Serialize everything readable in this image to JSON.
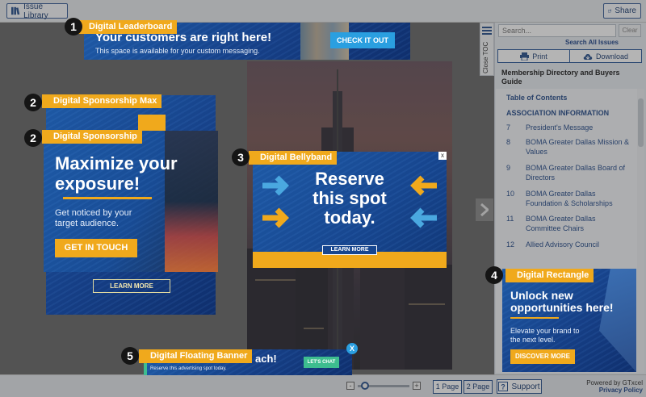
{
  "topbar": {
    "issue_library": "Issue Library",
    "share": "Share"
  },
  "toc": {
    "tab_label": "Close TOC",
    "search_placeholder": "Search...",
    "clear": "Clear",
    "search_all": "Search All Issues",
    "print": "Print",
    "download": "Download",
    "title": "Membership Directory and Buyers Guide",
    "items": [
      {
        "num": "",
        "text": "Table of Contents"
      },
      {
        "num": "",
        "text": "ASSOCIATION INFORMATION"
      },
      {
        "num": "7",
        "text": "President's Message"
      },
      {
        "num": "8",
        "text": "BOMA Greater Dallas Mission & Values"
      },
      {
        "num": "9",
        "text": "BOMA Greater Dallas Board of Directors"
      },
      {
        "num": "10",
        "text": "BOMA Greater Dallas Foundation & Scholarships"
      },
      {
        "num": "11",
        "text": "BOMA Greater Dallas Committee Chairs"
      },
      {
        "num": "12",
        "text": "Allied Advisory Council"
      }
    ]
  },
  "ads": {
    "leaderboard": {
      "badge": "1",
      "tag": "Digital Leaderboard",
      "headline": "Your customers are right here!",
      "sub": "This space is available for your custom messaging.",
      "cta": "CHECK IT OUT"
    },
    "sponsorship_max": {
      "badge": "2",
      "tag": "Digital Sponsorship Max",
      "cta": "LEARN MORE"
    },
    "sponsorship": {
      "badge": "2",
      "tag": "Digital Sponsorship",
      "headline": "Maximize your exposure!",
      "sub": "Get noticed by your target audience.",
      "cta": "GET IN TOUCH"
    },
    "bellyband": {
      "badge": "3",
      "tag": "Digital Bellyband",
      "headline": "Reserve this spot today.",
      "cta": "LEARN MORE",
      "close": "x"
    },
    "rectangle": {
      "badge": "4",
      "tag": "Digital Rectangle",
      "headline": "Unlock new opportunities here!",
      "sub": "Elevate your brand to the next level.",
      "cta": "DISCOVER MORE"
    },
    "floating": {
      "badge": "5",
      "tag": "Digital Floating Banner",
      "headline": "ach!",
      "sub": "Reserve this advertising spot today.",
      "cta": "LET'S CHAT",
      "close": "X"
    }
  },
  "bottombar": {
    "zoom_out": "-",
    "zoom_in": "+",
    "one_page": "1 Page",
    "two_page": "2 Page",
    "support": "Support",
    "powered_by": "Powered by GTxcel",
    "privacy": "Privacy Policy"
  },
  "colors": {
    "accent_orange": "#f0a91c",
    "ad_blue": "#1e5aa6",
    "nav_blue": "#1f3f74",
    "arrow_cyan": "#4aa8e0"
  }
}
